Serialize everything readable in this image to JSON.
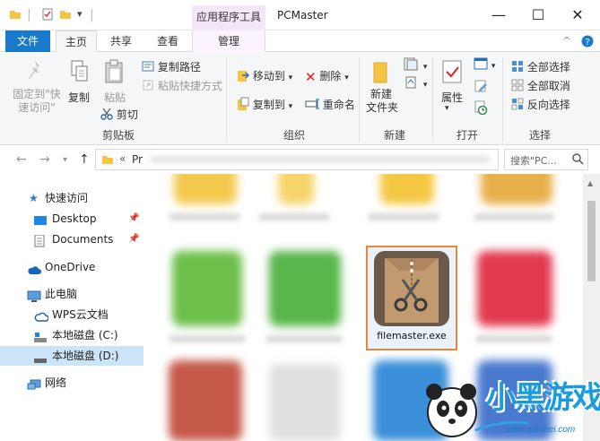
{
  "window": {
    "title": "PCMaster",
    "context_tab": "应用程序工具",
    "controls": [
      "—",
      "☐",
      "✕"
    ]
  },
  "tabs": {
    "file": "文件",
    "home": "主页",
    "share": "共享",
    "view": "查看",
    "manage": "管理"
  },
  "ribbon": {
    "clipboard": {
      "label": "剪贴板",
      "pin_quick_access": "固定到\"快速访问\"",
      "pin_line1": "固定到\"快",
      "pin_line2": "速访问\"",
      "copy": "复制",
      "paste": "粘贴",
      "copy_path": "复制路径",
      "paste_shortcut": "粘贴快捷方式",
      "cut": "剪切"
    },
    "organize": {
      "label": "组织",
      "move_to": "移动到",
      "copy_to": "复制到",
      "delete": "删除",
      "rename": "重命名"
    },
    "new": {
      "label": "新建",
      "new_folder_line1": "新建",
      "new_folder_line2": "文件夹"
    },
    "open": {
      "label": "打开",
      "properties": "属性"
    },
    "select": {
      "label": "选择",
      "select_all": "全部选择",
      "select_none": "全部取消",
      "invert": "反向选择"
    }
  },
  "address": {
    "path_prefix": "«",
    "path_text": "Pr",
    "search_placeholder": "搜索\"PC..."
  },
  "nav": {
    "quick_access": "快速访问",
    "desktop": "Desktop",
    "documents": "Documents",
    "onedrive": "OneDrive",
    "this_pc": "此电脑",
    "wps": "WPS云文档",
    "drive_c": "本地磁盘 (C:)",
    "drive_d": "本地磁盘 (D:)",
    "network": "网络"
  },
  "content": {
    "selected_file": "filemaster.exe"
  },
  "watermark": {
    "text": "小黑游戏",
    "url": "www.xiaohei.com"
  },
  "colors": {
    "file_tab": "#1979ca",
    "context_tab": "#f4e6f9",
    "selection_border": "#e8873a",
    "nav_selected": "#cce4f7"
  }
}
